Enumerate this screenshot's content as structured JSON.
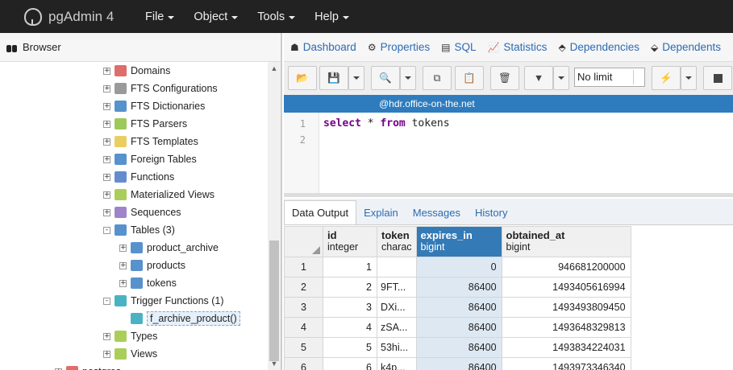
{
  "app": {
    "title": "pgAdmin 4"
  },
  "menu": [
    {
      "label": "File"
    },
    {
      "label": "Object"
    },
    {
      "label": "Tools"
    },
    {
      "label": "Help"
    }
  ],
  "browser": {
    "title": "Browser",
    "tree": [
      {
        "label": "Domains",
        "icon": "domains-icon",
        "color": "#d9534f"
      },
      {
        "label": "FTS Configurations",
        "icon": "fts-configurations-icon",
        "color": "#888888"
      },
      {
        "label": "FTS Dictionaries",
        "icon": "fts-dictionaries-icon",
        "color": "#3a7fc4"
      },
      {
        "label": "FTS Parsers",
        "icon": "fts-parsers-icon",
        "color": "#8bbf3f"
      },
      {
        "label": "FTS Templates",
        "icon": "fts-templates-icon",
        "color": "#e8c547"
      },
      {
        "label": "Foreign Tables",
        "icon": "foreign-tables-icon",
        "color": "#3a7fc4"
      },
      {
        "label": "Functions",
        "icon": "functions-icon",
        "color": "#4a78c8"
      },
      {
        "label": "Materialized Views",
        "icon": "materialized-views-icon",
        "color": "#9bc53d"
      },
      {
        "label": "Sequences",
        "icon": "sequences-icon",
        "color": "#8e6fc0"
      },
      {
        "label": "Tables (3)",
        "icon": "tables-icon",
        "color": "#3a7fc4"
      },
      {
        "label": "product_archive",
        "icon": "table-icon",
        "color": "#3a7fc4"
      },
      {
        "label": "products",
        "icon": "table-icon",
        "color": "#3a7fc4"
      },
      {
        "label": "tokens",
        "icon": "table-icon",
        "color": "#3a7fc4"
      },
      {
        "label": "Trigger Functions (1)",
        "icon": "trigger-functions-icon",
        "color": "#2aa6b7"
      },
      {
        "label": "f_archive_product()",
        "icon": "trigger-function-icon",
        "color": "#2aa6b7"
      },
      {
        "label": "Types",
        "icon": "types-icon",
        "color": "#9bc53d"
      },
      {
        "label": "Views",
        "icon": "views-icon",
        "color": "#9bc53d"
      },
      {
        "label": "postgres",
        "icon": "database-icon",
        "color": "#d9534f"
      }
    ]
  },
  "tabs": [
    {
      "label": "Dashboard",
      "icon": "dashboard-icon"
    },
    {
      "label": "Properties",
      "icon": "properties-icon"
    },
    {
      "label": "SQL",
      "icon": "sql-icon"
    },
    {
      "label": "Statistics",
      "icon": "statistics-icon"
    },
    {
      "label": "Dependencies",
      "icon": "dependencies-icon"
    },
    {
      "label": "Dependents",
      "icon": "dependents-icon"
    }
  ],
  "toolbar": {
    "limit_value": "No limit"
  },
  "connection": "@hdr.office-on-the.net",
  "editor": {
    "line_numbers": [
      "1",
      "2"
    ],
    "query": {
      "kw1": "select",
      "mid": " * ",
      "kw2": "from",
      "rest": " tokens"
    }
  },
  "output_tabs": [
    {
      "label": "Data Output",
      "active": true
    },
    {
      "label": "Explain"
    },
    {
      "label": "Messages"
    },
    {
      "label": "History"
    }
  ],
  "grid": {
    "columns": [
      {
        "name": "id",
        "type": "integer"
      },
      {
        "name": "token",
        "type": "charac"
      },
      {
        "name": "expires_in",
        "type": "bigint"
      },
      {
        "name": "obtained_at",
        "type": "bigint"
      }
    ],
    "rows": [
      {
        "n": "1",
        "id": "1",
        "token": "",
        "expires_in": "0",
        "obtained_at": "946681200000"
      },
      {
        "n": "2",
        "id": "2",
        "token": "9FT...",
        "expires_in": "86400",
        "obtained_at": "1493405616994"
      },
      {
        "n": "3",
        "id": "3",
        "token": "DXi...",
        "expires_in": "86400",
        "obtained_at": "1493493809450"
      },
      {
        "n": "4",
        "id": "4",
        "token": "zSA...",
        "expires_in": "86400",
        "obtained_at": "1493648329813"
      },
      {
        "n": "5",
        "id": "5",
        "token": "53hi...",
        "expires_in": "86400",
        "obtained_at": "1493834224031"
      },
      {
        "n": "6",
        "id": "6",
        "token": "k4p...",
        "expires_in": "86400",
        "obtained_at": "1493973346340"
      }
    ]
  }
}
